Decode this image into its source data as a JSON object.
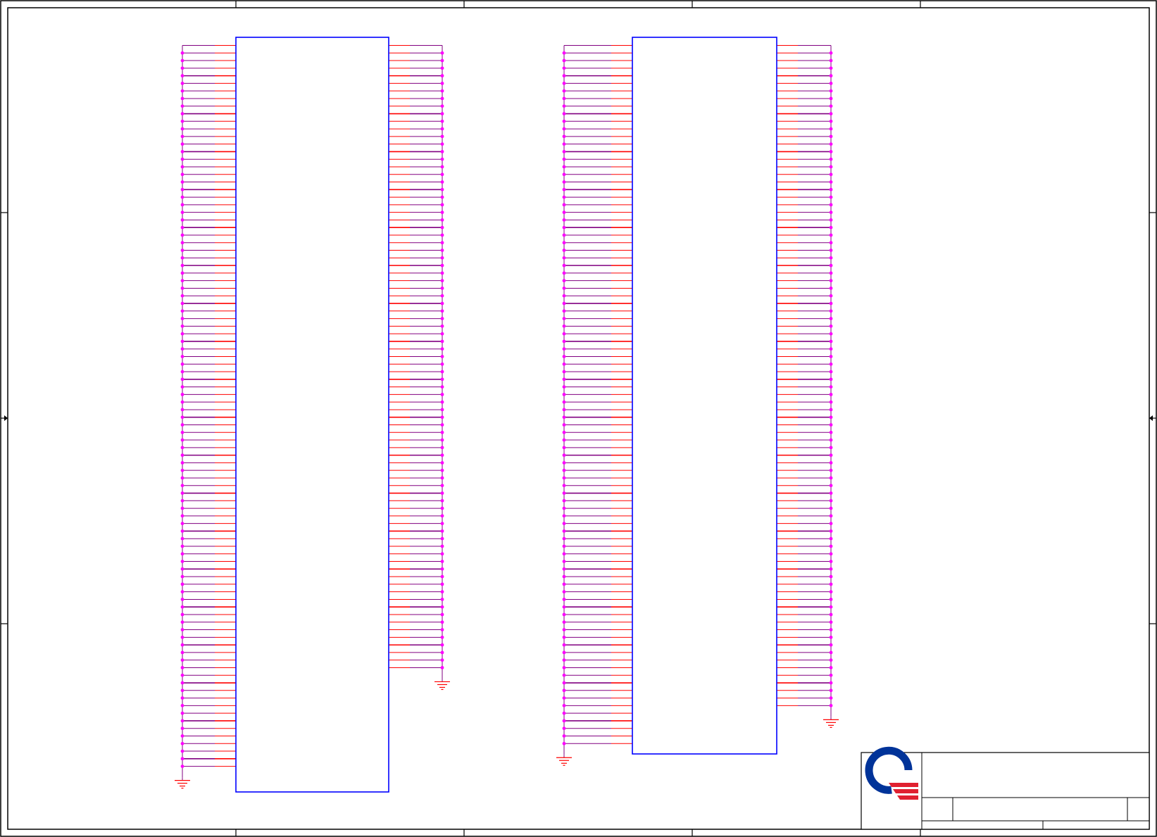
{
  "sheet": {
    "colors": {
      "border": "#000000",
      "component_outline": "#0000ff",
      "pin_line": "#ff0000",
      "net_wire": "#800080",
      "junction": "#ff00ff",
      "ground_symbol": "#ff0000",
      "logo_blue": "#003399",
      "logo_red": "#e02030"
    }
  },
  "schematic": {
    "components": [
      {
        "id": "connector-1",
        "left_pin_count": 96,
        "right_pin_count": 83
      },
      {
        "id": "connector-2",
        "left_pin_count": 93,
        "right_pin_count": 88
      }
    ],
    "ground_symbols": 4
  },
  "title_block": {
    "logo_icon": "company-logo-icon",
    "title": "",
    "size": "",
    "document_number": "",
    "rev": "",
    "date": "",
    "sheet": ""
  }
}
